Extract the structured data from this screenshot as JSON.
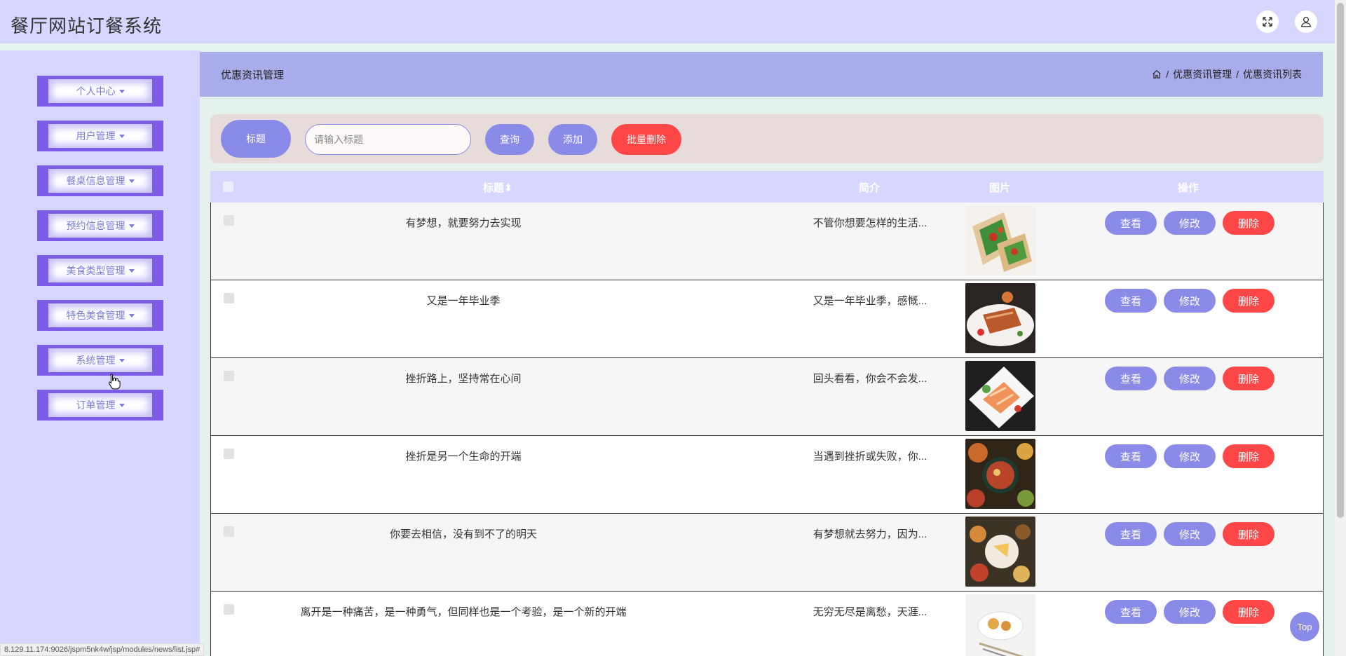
{
  "app": {
    "title": "餐厅网站订餐系统"
  },
  "sidebar": {
    "items": [
      {
        "label": "个人中心"
      },
      {
        "label": "用户管理"
      },
      {
        "label": "餐桌信息管理"
      },
      {
        "label": "预约信息管理"
      },
      {
        "label": "美食类型管理"
      },
      {
        "label": "特色美食管理"
      },
      {
        "label": "系统管理"
      },
      {
        "label": "订单管理"
      }
    ]
  },
  "header": {
    "title": "优惠资讯管理",
    "breadcrumb": [
      "优惠资讯管理",
      "优惠资讯列表"
    ]
  },
  "search": {
    "label": "标题",
    "placeholder": "请输入标题",
    "query_label": "查询",
    "add_label": "添加",
    "batch_delete_label": "批量删除"
  },
  "table": {
    "columns": [
      "标题",
      "简介",
      "图片",
      "操作"
    ],
    "actions": {
      "view": "查看",
      "edit": "修改",
      "delete": "删除"
    },
    "rows": [
      {
        "title": "有梦想，就要努力去实现",
        "intro": "不管你想要怎样的生活...",
        "image": "wrap-food"
      },
      {
        "title": "又是一年毕业季",
        "intro": "又是一年毕业季，感慨...",
        "image": "salmon-dish"
      },
      {
        "title": "挫折路上，坚持常在心间",
        "intro": "回头看看，你会不会发...",
        "image": "sashimi-plate"
      },
      {
        "title": "挫折是另一个生命的开端",
        "intro": "当遇到挫折或失败，你...",
        "image": "table-spread"
      },
      {
        "title": "你要去相信，没有到不了的明天",
        "intro": "有梦想就去努力，因为...",
        "image": "cheese-platter"
      },
      {
        "title": "离开是一种痛苦，是一种勇气，但同样也是一个考验，是一个新的开端",
        "intro": "无穷无尽是离愁，天涯...",
        "image": "pastry-plate"
      }
    ]
  },
  "status_url": "8.129.11.174:9026/jspm5nk4w/jsp/modules/news/list.jsp#",
  "top_button": "Top",
  "colors": {
    "accent": "#8a8ae8",
    "danger": "#ff4747",
    "menu_border": "#7d5ce8",
    "topbar": "#d6d6ff"
  }
}
